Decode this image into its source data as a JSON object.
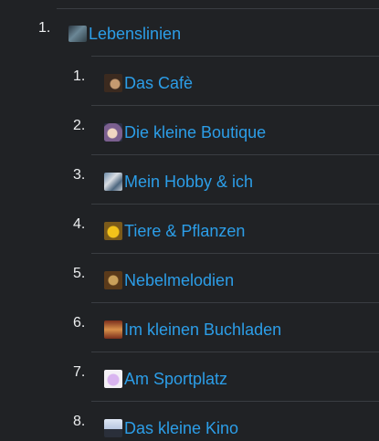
{
  "outline": {
    "parent": {
      "number": "1.",
      "label": "Lebenslinien",
      "icon": "lebenslinien-thumbnail-icon"
    },
    "children": [
      {
        "number": "1.",
        "label": "Das Cafè",
        "icon": "cafe-thumbnail-icon"
      },
      {
        "number": "2.",
        "label": "Die kleine Boutique",
        "icon": "boutique-thumbnail-icon"
      },
      {
        "number": "3.",
        "label": "Mein Hobby & ich",
        "icon": "hobby-thumbnail-icon"
      },
      {
        "number": "4.",
        "label": "Tiere & Pflanzen",
        "icon": "tiere-thumbnail-icon"
      },
      {
        "number": "5.",
        "label": "Nebelmelodien",
        "icon": "nebel-thumbnail-icon"
      },
      {
        "number": "6.",
        "label": "Im kleinen Buchladen",
        "icon": "buchladen-thumbnail-icon"
      },
      {
        "number": "7.",
        "label": "Am Sportplatz",
        "icon": "sportplatz-thumbnail-icon"
      },
      {
        "number": "8.",
        "label": "Das kleine Kino",
        "icon": "kino-thumbnail-icon"
      }
    ]
  },
  "colors": {
    "background": "#202225",
    "link": "#2c9ee8",
    "number": "#eceef0",
    "divider": "#3a3d42"
  }
}
